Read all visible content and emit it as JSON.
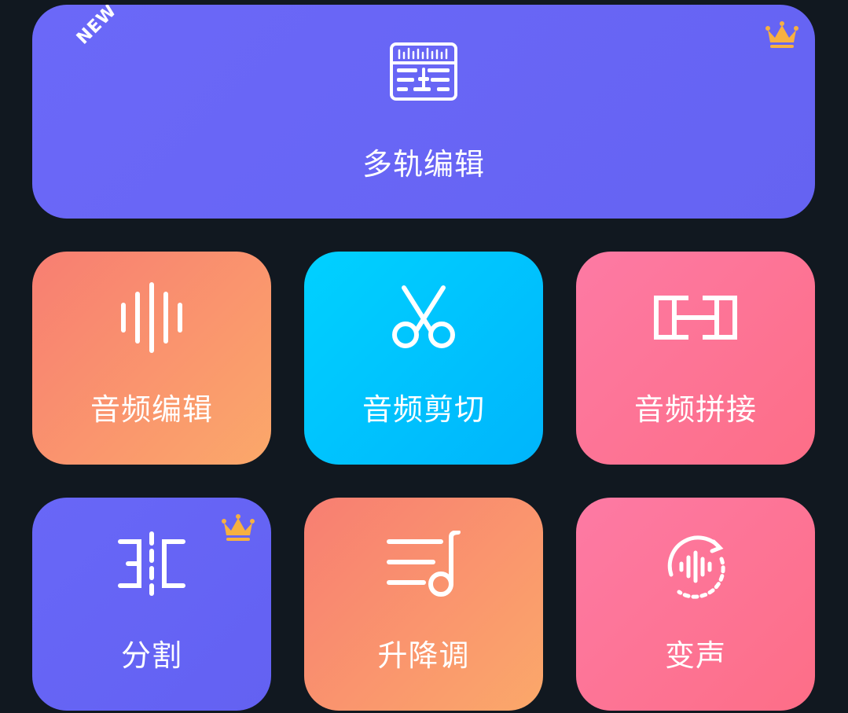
{
  "tiles": {
    "multitrack": {
      "label": "多轨编辑",
      "badge": "NEW",
      "premium": true,
      "icon": "multitrack-timeline-icon"
    },
    "audio_edit": {
      "label": "音频编辑",
      "premium": false,
      "icon": "waveform-icon"
    },
    "audio_cut": {
      "label": "音频剪切",
      "premium": false,
      "icon": "scissors-icon"
    },
    "audio_join": {
      "label": "音频拼接",
      "premium": false,
      "icon": "join-blocks-icon"
    },
    "split": {
      "label": "分割",
      "premium": true,
      "icon": "split-icon"
    },
    "pitch": {
      "label": "升降调",
      "premium": false,
      "icon": "music-pitch-icon"
    },
    "voice_change": {
      "label": "变声",
      "premium": false,
      "icon": "voice-change-icon"
    }
  },
  "colors": {
    "background": "#111820",
    "purple": "#6563f2",
    "orange_start": "#f87e72",
    "orange_end": "#fba86a",
    "cyan_start": "#00d1ff",
    "cyan_end": "#00b5fc",
    "pink_start": "#fd7aa4",
    "pink_end": "#fd6e87",
    "crown": "#f7b041"
  }
}
